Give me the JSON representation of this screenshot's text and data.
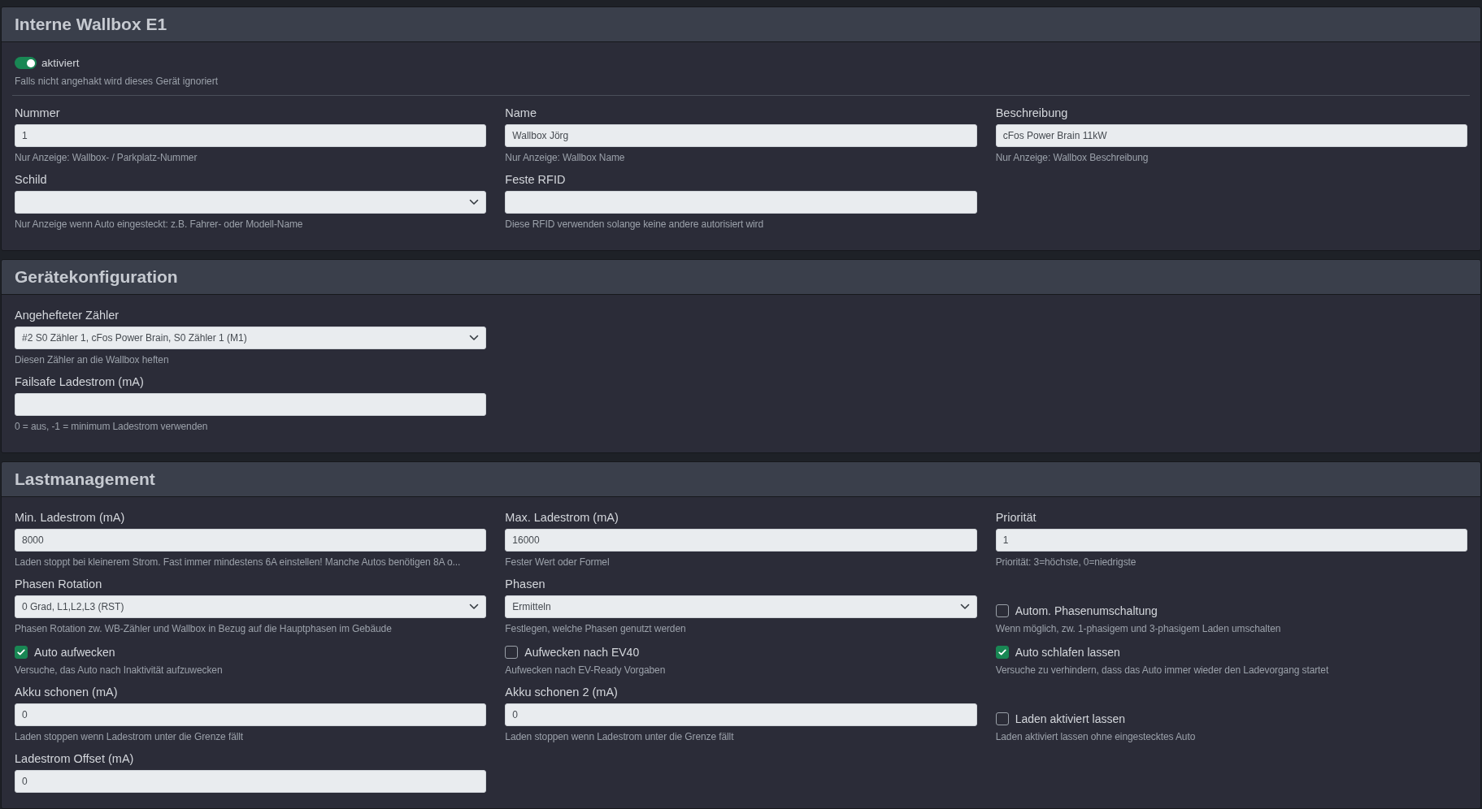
{
  "sections": [
    {
      "title": "Interne Wallbox E1",
      "switch": {
        "label": "aktiviert",
        "on": true,
        "hint": "Falls nicht angehakt wird dieses Gerät ignoriert"
      },
      "rows": [
        [
          {
            "kind": "text",
            "label": "Nummer",
            "value": "1",
            "hint": "Nur Anzeige: Wallbox- / Parkplatz-Nummer"
          },
          {
            "kind": "text",
            "label": "Name",
            "value": "Wallbox Jörg",
            "hint": "Nur Anzeige: Wallbox Name"
          },
          {
            "kind": "text",
            "label": "Beschreibung",
            "value": "cFos Power Brain 11kW",
            "hint": "Nur Anzeige: Wallbox Beschreibung"
          }
        ],
        [
          {
            "kind": "select",
            "label": "Schild",
            "hint": "Nur Anzeige wenn Auto eingesteckt: z.B. Fahrer- oder Modell-Name"
          },
          {
            "kind": "text",
            "label": "Feste RFID",
            "hint": "Diese RFID verwenden solange keine andere autorisiert wird"
          }
        ]
      ]
    },
    {
      "title": "Gerätekonfiguration",
      "rows": [
        [
          {
            "kind": "select",
            "label": "Angehefteter Zähler",
            "value": "#2 S0 Zähler 1, cFos Power Brain, S0 Zähler 1 (M1)",
            "hint": "Diesen Zähler an die Wallbox heften"
          }
        ],
        [
          {
            "kind": "text",
            "label": "Failsafe Ladestrom (mA)",
            "hint": "0 = aus, -1 = minimum Ladestrom verwenden"
          }
        ]
      ]
    },
    {
      "title": "Lastmanagement",
      "rows": [
        [
          {
            "kind": "text",
            "label": "Min. Ladestrom (mA)",
            "value": "8000",
            "hint": "Laden stoppt bei kleinerem Strom. Fast immer mindestens 6A einstellen! Manche Autos benötigen 8A o..."
          },
          {
            "kind": "text",
            "label": "Max. Ladestrom (mA)",
            "value": "16000",
            "hint": "Fester Wert oder Formel"
          },
          {
            "kind": "text",
            "label": "Priorität",
            "value": "1",
            "hint": "Priorität: 3=höchste, 0=niedrigste"
          }
        ],
        [
          {
            "kind": "select",
            "label": "Phasen Rotation",
            "value": "0 Grad, L1,L2,L3 (RST)",
            "hint": "Phasen Rotation zw. WB-Zähler und Wallbox in Bezug auf die Hauptphasen im Gebäude"
          },
          {
            "kind": "select",
            "label": "Phasen",
            "value": "Ermitteln",
            "hint": "Festlegen, welche Phasen genutzt werden"
          },
          {
            "kind": "checkbox",
            "label": "Autom. Phasenumschaltung",
            "checked": false,
            "hint": "Wenn möglich, zw. 1-phasigem und 3-phasigem Laden umschalten"
          }
        ],
        [
          {
            "kind": "checkbox",
            "label": "Auto aufwecken",
            "checked": true,
            "hint": "Versuche, das Auto nach Inaktivität aufzuwecken"
          },
          {
            "kind": "checkbox",
            "label": "Aufwecken nach EV40",
            "checked": false,
            "hint": "Aufwecken nach EV-Ready Vorgaben"
          },
          {
            "kind": "checkbox",
            "label": "Auto schlafen lassen",
            "checked": true,
            "hint": "Versuche zu verhindern, dass das Auto immer wieder den Ladevorgang startet"
          }
        ],
        [
          {
            "kind": "text",
            "label": "Akku schonen (mA)",
            "value": "0",
            "hint": "Laden stoppen wenn Ladestrom unter die Grenze fällt"
          },
          {
            "kind": "text",
            "label": "Akku schonen 2 (mA)",
            "value": "0",
            "hint": "Laden stoppen wenn Ladestrom unter die Grenze fällt"
          },
          {
            "kind": "checkbox",
            "label": "Laden aktiviert lassen",
            "checked": false,
            "hint": "Laden aktiviert lassen ohne eingestecktes Auto"
          }
        ],
        [
          {
            "kind": "text",
            "label": "Ladestrom Offset (mA)",
            "value": "0"
          }
        ]
      ]
    }
  ]
}
